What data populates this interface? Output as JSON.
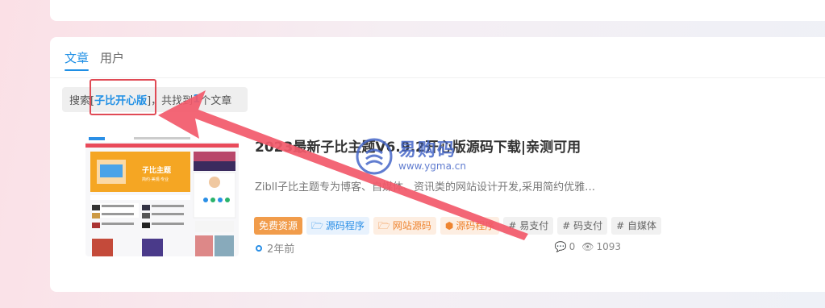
{
  "tabs": [
    {
      "label": "文章",
      "active": true
    },
    {
      "label": "用户",
      "active": false
    }
  ],
  "search_info": {
    "prefix": "搜索[",
    "keyword": "子比开心版",
    "suffix": "]，共找到",
    "count": "1",
    "unit": "个文章"
  },
  "post": {
    "title": "2023最新子比主题V6.9.2开心版源码下载|亲测可用",
    "excerpt": "Zibll子比主题专为博客、自媒体、资讯类的网站设计开发,采用简约优雅…",
    "tags": [
      {
        "label": "免费资源",
        "style": "orange-solid",
        "icon": ""
      },
      {
        "label": "源码程序",
        "style": "blue",
        "icon": "folder-icon"
      },
      {
        "label": "网站源码",
        "style": "orange",
        "icon": "folder-icon"
      },
      {
        "label": "源码程序",
        "style": "orange",
        "icon": "box-icon"
      },
      {
        "label": "# 易支付",
        "style": "gray",
        "icon": ""
      },
      {
        "label": "# 码支付",
        "style": "gray",
        "icon": ""
      },
      {
        "label": "# 自媒体",
        "style": "gray",
        "icon": ""
      }
    ],
    "time": "2年前",
    "comments": "0",
    "views": "1093",
    "thumbnail_banner": "子比主题",
    "thumbnail_sub": "简约·美观·专业"
  },
  "watermark": {
    "cn": "易购码",
    "url": "www.ygma.cn"
  },
  "colors": {
    "accent": "#1f8fe5",
    "highlight": "#e04a55",
    "arrow": "#f2596a"
  }
}
